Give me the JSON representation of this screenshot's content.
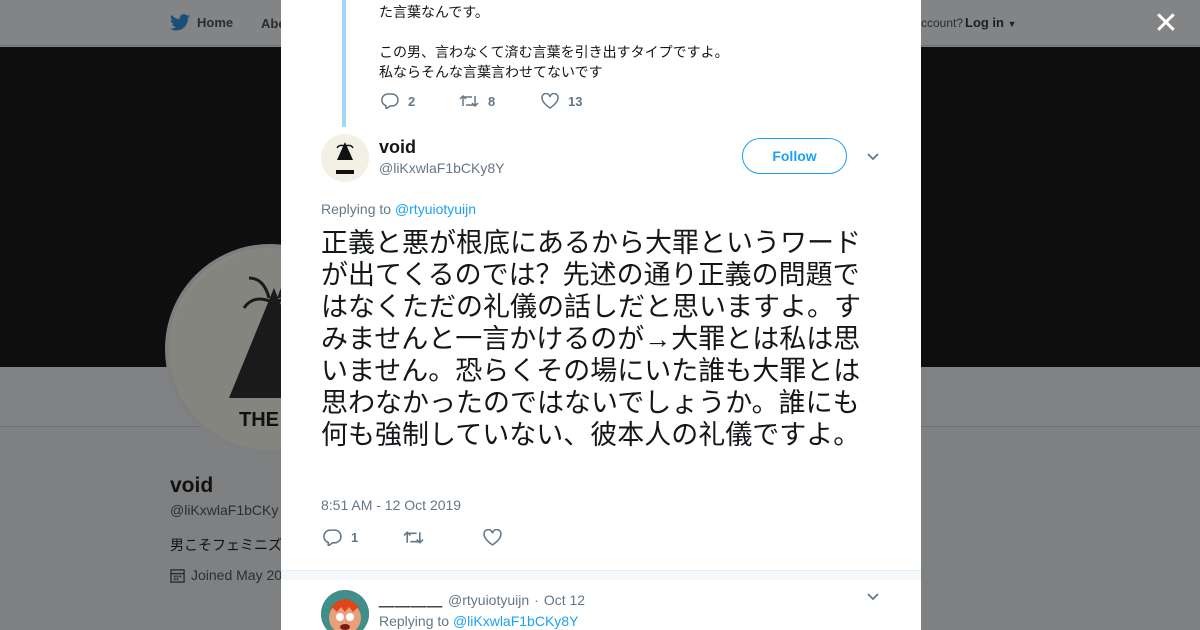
{
  "topbar": {
    "home_label": "Home",
    "about_label": "Abo",
    "account_text": "ccount?",
    "login_label": "Log in"
  },
  "profile": {
    "name": "void",
    "handle": "@liKxwlaF1bCKy",
    "bio": "男こそフェミニズ",
    "joined": "Joined May 20"
  },
  "previous_tweet": {
    "text": "た言葉なんです。\n\nこの男、言わなくて済む言葉を引き出すタイプですよ。\n私ならそんな言葉言わせてないです",
    "replies": "2",
    "retweets": "8",
    "likes": "13"
  },
  "tweet": {
    "author_name": "void",
    "author_handle": "@liKxwlaF1bCKy8Y",
    "follow_label": "Follow",
    "replying_prefix": "Replying to",
    "replying_to": "@rtyuiotyuijn",
    "text": "正義と悪が根底にあるから大罪というワードが出てくるのでは？先述の通り正義の問題ではなくただの礼儀の話しだと思いますよ。すみませんと一言かけるのが→大罪とは私は思いません。恐らくその場にいた誰も大罪とは思わなかったのではないでしょうか。誰にも何も強制していない、彼本人の礼儀ですよ。",
    "timestamp": "8:51 AM - 12 Oct 2019",
    "replies": "1"
  },
  "reply": {
    "name": "＿＿＿＿",
    "handle": "@rtyuiotyuijn",
    "date": "Oct 12",
    "replying_prefix": "Replying to",
    "replying_to": "@liKxwlaF1bCKy8Y"
  },
  "colors": {
    "accent": "#1da1f2",
    "thread_line": "#9fd6f7",
    "muted": "#657786"
  },
  "icons": [
    "twitter-bird-icon",
    "close-icon",
    "reply-icon",
    "retweet-icon",
    "like-icon",
    "chevron-down-icon",
    "calendar-icon"
  ]
}
